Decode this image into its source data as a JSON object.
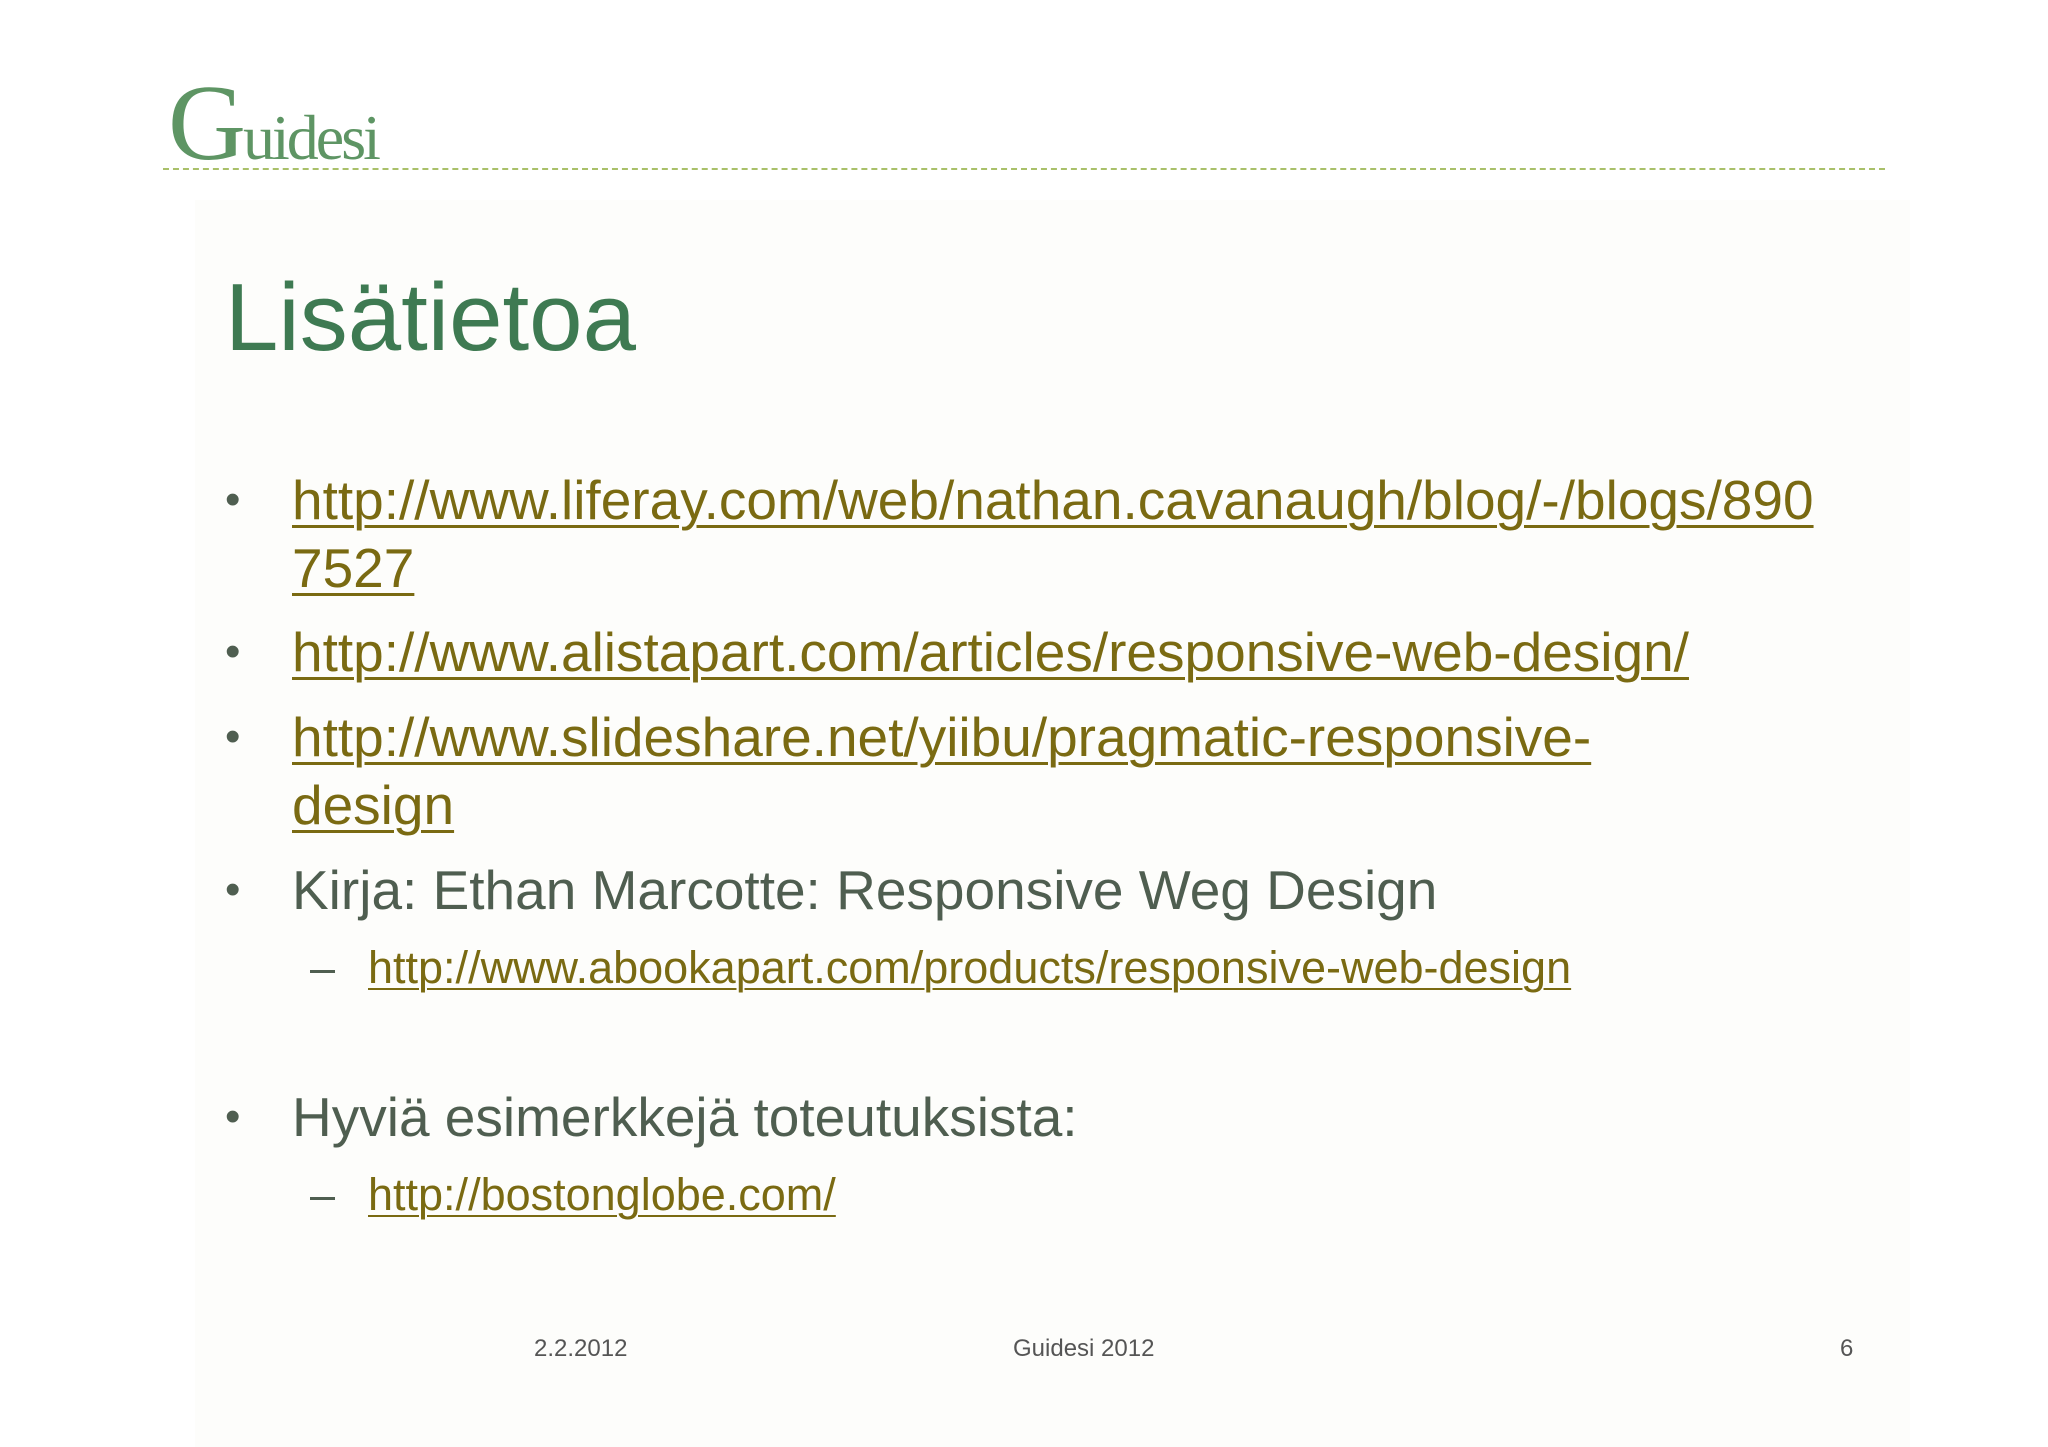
{
  "logo": {
    "text_big": "G",
    "text_small": "uidesi"
  },
  "slide": {
    "title": "Lisätietoa",
    "items": [
      {
        "bullet": "•",
        "text": "http://www.liferay.com/web/nathan.cavanaugh/blog/-/blogs/8907527"
      },
      {
        "bullet": "•",
        "text": "http://www.alistapart.com/articles/responsive-web-design/"
      },
      {
        "bullet": "•",
        "text": "http://www.slideshare.net/yiibu/pragmatic-responsive-design"
      },
      {
        "bullet": "•",
        "text": "Kirja: Ethan Marcotte: Responsive Weg Design"
      },
      {
        "bullet": "•",
        "text": "Hyviä esimerkkejä toteutuksista:"
      }
    ],
    "sub_items": [
      {
        "dash": "–",
        "text": "http://www.abookapart.com/products/responsive-web-design"
      },
      {
        "dash": "–",
        "text": "http://bostonglobe.com/"
      }
    ]
  },
  "footer": {
    "date": "2.2.2012",
    "center": "Guidesi 2012",
    "page_number": "6"
  },
  "colors": {
    "title": "#3e7a52",
    "link": "#7a6a12",
    "body_text": "#4f5e50",
    "divider": "#a9c06a",
    "logo": "#5e9564"
  }
}
